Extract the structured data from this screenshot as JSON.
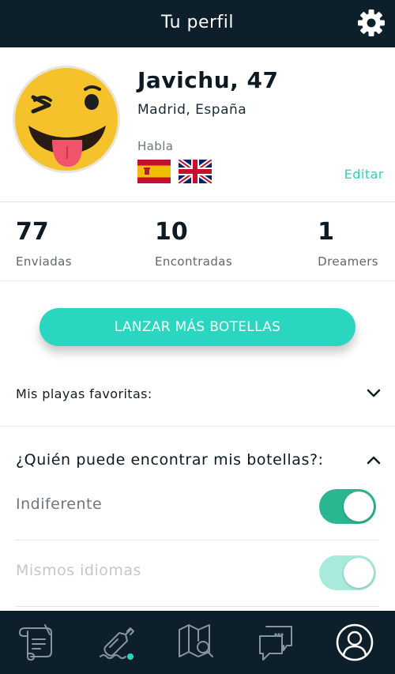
{
  "header": {
    "title": "Tu perfil",
    "settings_icon": "gear-icon"
  },
  "profile": {
    "name": "Javichu, 47",
    "location": "Madrid, España",
    "speaks_label": "Habla",
    "languages": [
      "spain-flag",
      "uk-flag"
    ],
    "edit_label": "Editar",
    "avatar_icon": "winking-tongue-emoji"
  },
  "stats": [
    {
      "value": "77",
      "label": "Enviadas"
    },
    {
      "value": "10",
      "label": "Encontradas"
    },
    {
      "value": "1",
      "label": "Dreamers"
    }
  ],
  "launch_button": "LANZAR MÁS BOTELLAS",
  "favorites": {
    "label": "Mis playas favoritas:",
    "expanded": false
  },
  "visibility": {
    "title": "¿Quién puede encontrar mis botellas?:",
    "expanded": true,
    "options": [
      {
        "label": "Indiferente",
        "on": true,
        "enabled": true
      },
      {
        "label": "Mismos idiomas",
        "on": true,
        "enabled": false
      }
    ]
  },
  "tabbar": {
    "tabs": [
      "scroll-icon",
      "bottle-icon",
      "map-search-icon",
      "chat-icon",
      "profile-icon"
    ],
    "active_tab": "profile-icon"
  },
  "colors": {
    "header": "#0e1f2c",
    "accent": "#2ad6bf",
    "toggle_on": "#2ab690",
    "toggle_disabled": "#a8eadc"
  }
}
